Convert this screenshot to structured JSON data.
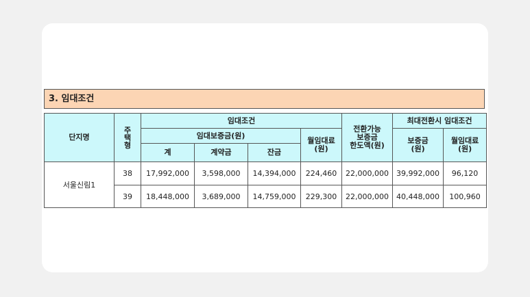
{
  "section": {
    "title": "3.  임대조건"
  },
  "table": {
    "headers": {
      "complex_name": "단지명",
      "housing_type": [
        "주",
        "택",
        "형"
      ],
      "rental_conditions": "임대조건",
      "rental_deposit": "임대보증금(원)",
      "total": "계",
      "contract_fee": "계약금",
      "balance": "잔금",
      "monthly_rent": [
        "월임대료",
        "(원)"
      ],
      "convertible_deposit_limit": [
        "전환가능",
        "보증금",
        "한도액(원)"
      ],
      "max_conversion_conditions": "최대전환시  임대조건",
      "max_deposit": [
        "보증금",
        "(원)"
      ],
      "max_monthly_rent": [
        "월임대료",
        "(원)"
      ]
    },
    "complex": "서울신림1",
    "rows": [
      {
        "type": "38",
        "total": "17,992,000",
        "contract_fee": "3,598,000",
        "balance": "14,394,000",
        "monthly_rent": "224,460",
        "convertible_limit": "22,000,000",
        "max_deposit": "39,992,000",
        "max_monthly_rent": "96,120"
      },
      {
        "type": "39",
        "total": "18,448,000",
        "contract_fee": "3,689,000",
        "balance": "14,759,000",
        "monthly_rent": "229,300",
        "convertible_limit": "22,000,000",
        "max_deposit": "40,448,000",
        "max_monthly_rent": "100,960"
      }
    ]
  }
}
